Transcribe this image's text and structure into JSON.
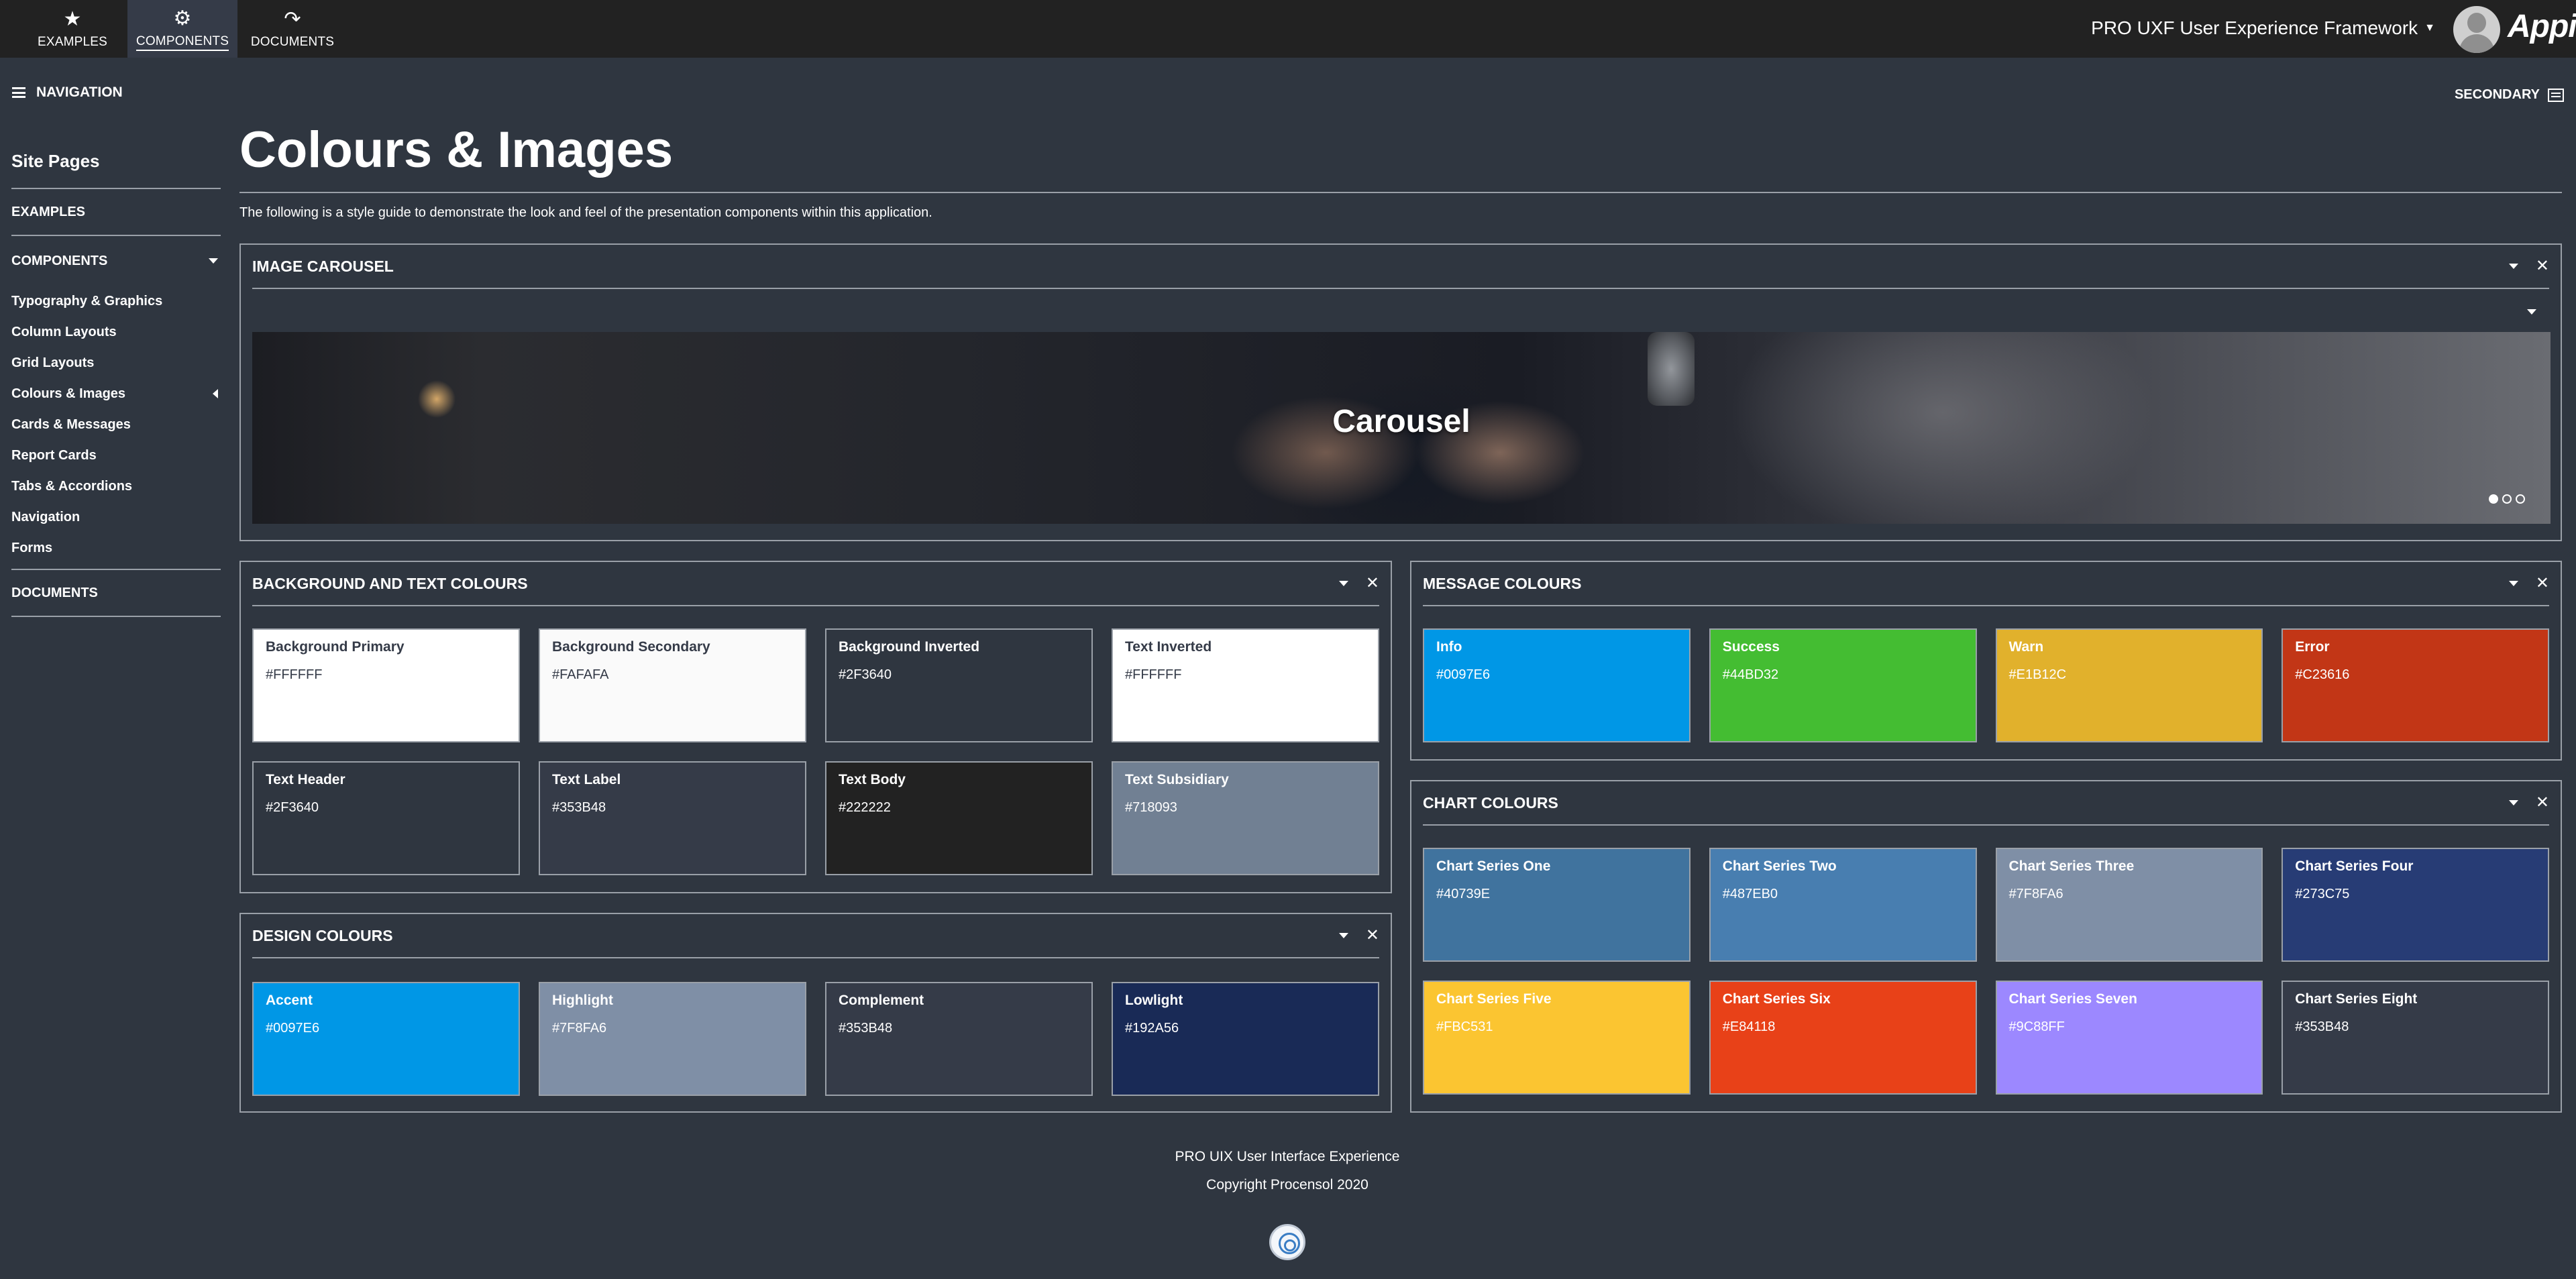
{
  "topbar": {
    "nav": [
      {
        "label": "EXAMPLES",
        "icon": "star-icon",
        "glyph": "★"
      },
      {
        "label": "COMPONENTS",
        "icon": "gear-icon",
        "glyph": "⚙"
      },
      {
        "label": "DOCUMENTS",
        "icon": "share-icon",
        "glyph": "↷"
      }
    ],
    "active_nav": "COMPONENTS",
    "app_name": "PRO UXF User Experience Framework",
    "brand": "Appian"
  },
  "sidebar": {
    "header": "NAVIGATION",
    "title": "Site Pages",
    "sections": {
      "examples": "EXAMPLES",
      "components": "COMPONENTS",
      "documents": "DOCUMENTS"
    },
    "component_links": [
      "Typography & Graphics",
      "Column Layouts",
      "Grid Layouts",
      "Colours & Images",
      "Cards & Messages",
      "Report Cards",
      "Tabs & Accordions",
      "Navigation",
      "Forms"
    ],
    "active_link": "Colours & Images"
  },
  "secondary": "SECONDARY",
  "main": {
    "title": "Colours & Images",
    "intro": "The following is a style guide to demonstrate the look and feel of the presentation components within this application."
  },
  "carousel": {
    "title": "IMAGE CAROUSEL",
    "caption": "Carousel",
    "slide_count": 3,
    "active_slide": 1
  },
  "bg_text_colours": {
    "title": "BACKGROUND AND TEXT COLOURS",
    "swatches": [
      {
        "name": "Background Primary",
        "hex": "#FFFFFF",
        "bg": "#FFFFFF",
        "fg": "#353B48"
      },
      {
        "name": "Background Secondary",
        "hex": "#FAFAFA",
        "bg": "#FAFAFA",
        "fg": "#353B48"
      },
      {
        "name": "Background Inverted",
        "hex": "#2F3640",
        "bg": "#2F3640",
        "fg": "#FFFFFF"
      },
      {
        "name": "Text Inverted",
        "hex": "#FFFFFF",
        "bg": "#FFFFFF",
        "fg": "#353B48"
      },
      {
        "name": "Text Header",
        "hex": "#2F3640",
        "bg": "#2F3640",
        "fg": "#FFFFFF"
      },
      {
        "name": "Text Label",
        "hex": "#353B48",
        "bg": "#353B48",
        "fg": "#FFFFFF"
      },
      {
        "name": "Text Body",
        "hex": "#222222",
        "bg": "#222222",
        "fg": "#FFFFFF"
      },
      {
        "name": "Text Subsidiary",
        "hex": "#718093",
        "bg": "#718093",
        "fg": "#FFFFFF"
      }
    ]
  },
  "design_colours": {
    "title": "DESIGN COLOURS",
    "swatches": [
      {
        "name": "Accent",
        "hex": "#0097E6",
        "bg": "#0097E6",
        "fg": "#FFFFFF"
      },
      {
        "name": "Highlight",
        "hex": "#7F8FA6",
        "bg": "#7F8FA6",
        "fg": "#FFFFFF"
      },
      {
        "name": "Complement",
        "hex": "#353B48",
        "bg": "#353B48",
        "fg": "#FFFFFF"
      },
      {
        "name": "Lowlight",
        "hex": "#192A56",
        "bg": "#192A56",
        "fg": "#FFFFFF"
      }
    ]
  },
  "message_colours": {
    "title": "MESSAGE COLOURS",
    "swatches": [
      {
        "name": "Info",
        "hex": "#0097E6",
        "bg": "#0097E6",
        "fg": "#FFFFFF"
      },
      {
        "name": "Success",
        "hex": "#44BD32",
        "bg": "#44BD32",
        "fg": "#FFFFFF"
      },
      {
        "name": "Warn",
        "hex": "#E1B12C",
        "bg": "#E1B12C",
        "fg": "#FFFFFF"
      },
      {
        "name": "Error",
        "hex": "#C23616",
        "bg": "#C23616",
        "fg": "#FFFFFF"
      }
    ]
  },
  "chart_colours": {
    "title": "CHART COLOURS",
    "swatches": [
      {
        "name": "Chart Series One",
        "hex": "#40739E",
        "bg": "#40739E",
        "fg": "#FFFFFF"
      },
      {
        "name": "Chart Series Two",
        "hex": "#487EB0",
        "bg": "#487EB0",
        "fg": "#FFFFFF"
      },
      {
        "name": "Chart Series Three",
        "hex": "#7F8FA6",
        "bg": "#7F8FA6",
        "fg": "#FFFFFF"
      },
      {
        "name": "Chart Series Four",
        "hex": "#273C75",
        "bg": "#273C75",
        "fg": "#FFFFFF"
      },
      {
        "name": "Chart Series Five",
        "hex": "#FBC531",
        "bg": "#FBC531",
        "fg": "#FFFFFF"
      },
      {
        "name": "Chart Series Six",
        "hex": "#E84118",
        "bg": "#E84118",
        "fg": "#FFFFFF"
      },
      {
        "name": "Chart Series Seven",
        "hex": "#9C88FF",
        "bg": "#9C88FF",
        "fg": "#FFFFFF"
      },
      {
        "name": "Chart Series Eight",
        "hex": "#353B48",
        "bg": "#353B48",
        "fg": "#FFFFFF"
      }
    ]
  },
  "footer": {
    "line1": "PRO UIX User Interface Experience",
    "line2": "Copyright Procensol 2020"
  }
}
